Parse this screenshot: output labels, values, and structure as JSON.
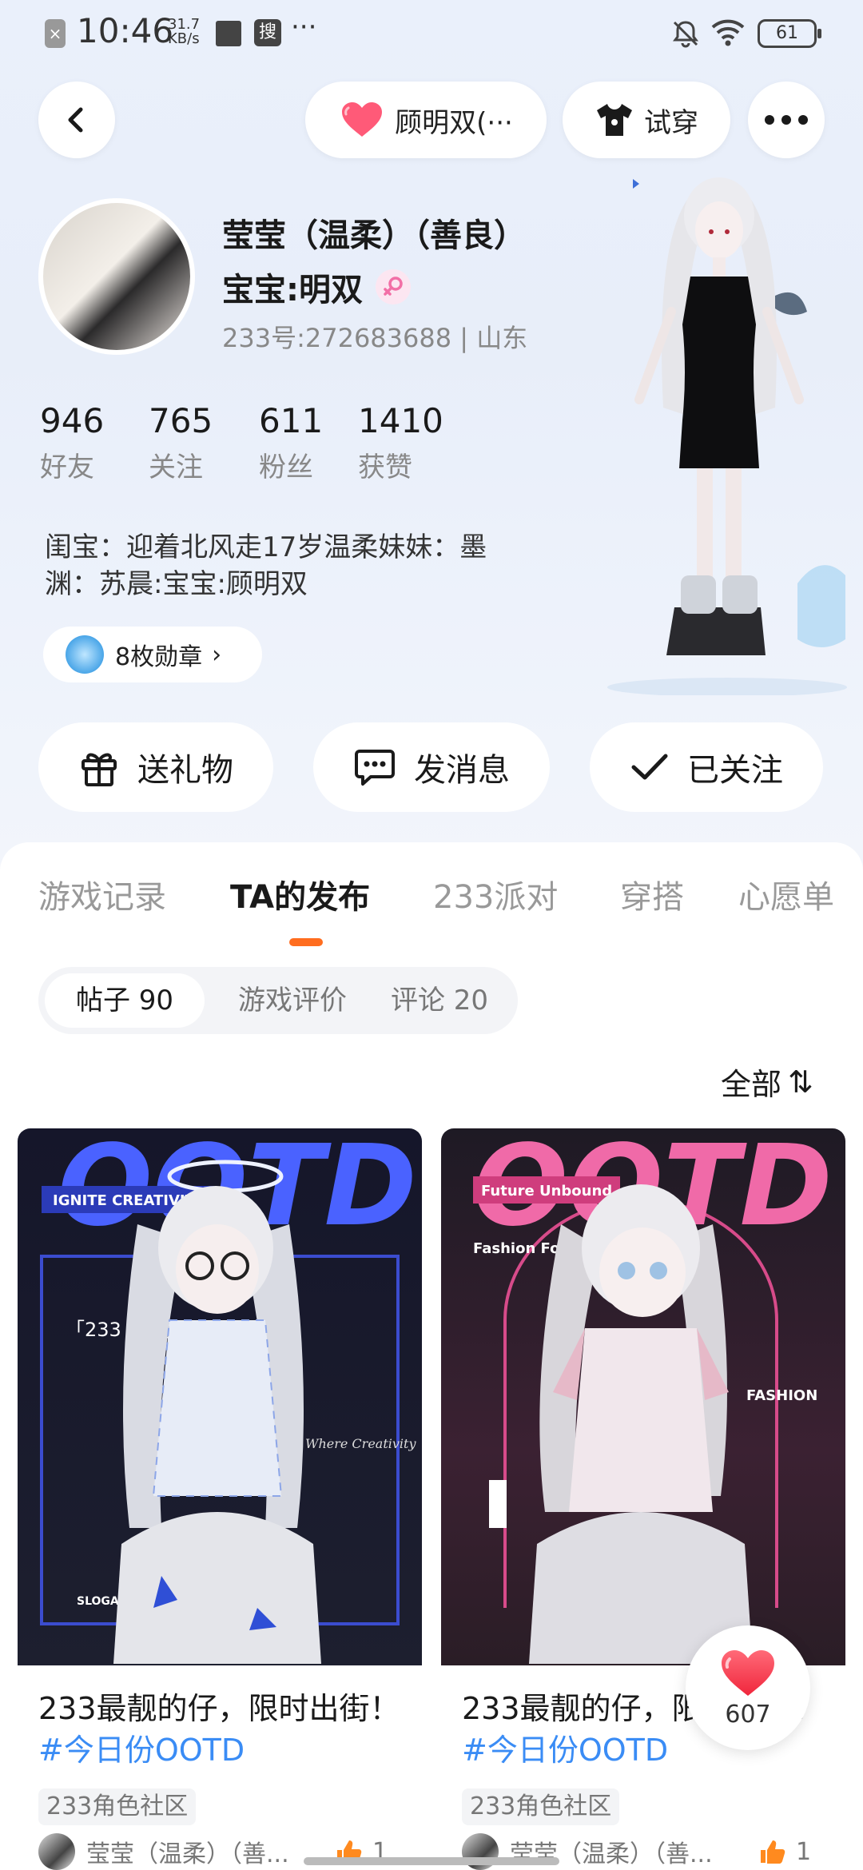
{
  "status_bar": {
    "time": "10:46",
    "net_speed": "31.7 KB/s",
    "search_glyph": "搜",
    "more": "···",
    "battery": "61"
  },
  "top_nav": {
    "cp_label": "顾明双(···",
    "tryon_label": "试穿"
  },
  "profile": {
    "name": "莹莹（温柔）（善良）",
    "cp_line": "宝宝:明双",
    "uid_line": "233号:272683688 | 山东",
    "bio": "闺宝：迎着北风走17岁温柔妹妹：墨渊：苏晨:宝宝:顾明双",
    "badge_label": "8枚勋章",
    "badge_arrow": "›"
  },
  "stats": [
    {
      "value": "946",
      "label": "好友"
    },
    {
      "value": "765",
      "label": "关注"
    },
    {
      "value": "611",
      "label": "粉丝"
    },
    {
      "value": "1410",
      "label": "获赞"
    }
  ],
  "actions": {
    "gift": "送礼物",
    "message": "发消息",
    "follow": "已关注"
  },
  "tabs": [
    "游戏记录",
    "TA的发布",
    "233派对",
    "穿搭",
    "心愿单"
  ],
  "sub_tabs": [
    "帖子 90",
    "游戏评价",
    "评论 20"
  ],
  "sort_label": "全部",
  "sort_icon": "⇅",
  "posts": [
    {
      "title": "233最靓的仔，限时出街！",
      "tag": "#今日份OOTD",
      "community": "233角色社区",
      "author": "莹莹（温柔）（善...",
      "likes": "1",
      "cover_text": {
        "headline": "OOTD",
        "sub": "IGNITE CREATIVITY",
        "party": "「233 派对」",
        "slogan": "SLOGAN:",
        "side": "Where Creativity"
      }
    },
    {
      "title": "233最靓的仔，限时出街！",
      "tag": "#今日份OOTD",
      "community": "233角色社区",
      "author": "莹莹（温柔）（善...",
      "likes": "1",
      "cover_text": {
        "headline": "OOTD",
        "sub": "Future Unbound",
        "forward": "Fashion Forward",
        "side": "FASHION"
      }
    }
  ],
  "float_like_count": "607",
  "colors": {
    "accent_orange": "#ff6d1f",
    "tag_blue": "#3a8cf5",
    "heart_red": "#ff3b4a"
  },
  "icons": [
    "back-icon",
    "heart-icon",
    "tshirt-icon",
    "more-icon",
    "gift-icon",
    "message-icon",
    "check-icon",
    "sort-icon",
    "like-icon",
    "medal-icon",
    "female-icon"
  ]
}
